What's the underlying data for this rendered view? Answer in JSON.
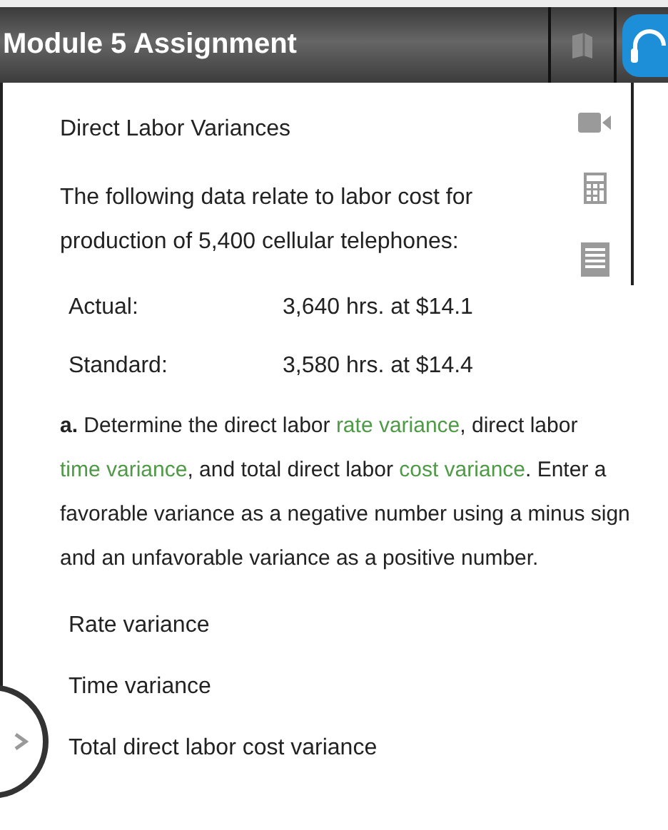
{
  "header": {
    "title": "Module 5 Assignment"
  },
  "heading": "Direct Labor Variances",
  "intro": "The following data relate to labor cost for production of 5,400 cellular telephones:",
  "data_rows": [
    {
      "label": "Actual:",
      "value": "3,640 hrs. at $14.1"
    },
    {
      "label": "Standard:",
      "value": "3,580 hrs. at $14.4"
    }
  ],
  "instruction": [
    {
      "text": "**a.** Determine the direct labor ",
      "term": false
    },
    {
      "text": "rate variance",
      "term": true
    },
    {
      "text": ", direct labor ",
      "term": false
    },
    {
      "text": "time variance",
      "term": true
    },
    {
      "text": ", and total direct labor ",
      "term": false
    },
    {
      "text": "cost variance",
      "term": true
    },
    {
      "text": ". Enter a favorable variance as a negative number using a minus sign and an unfavorable variance as a positive number.",
      "term": false
    }
  ],
  "answers": [
    "Rate variance",
    "Time variance",
    "Total direct labor cost variance"
  ]
}
